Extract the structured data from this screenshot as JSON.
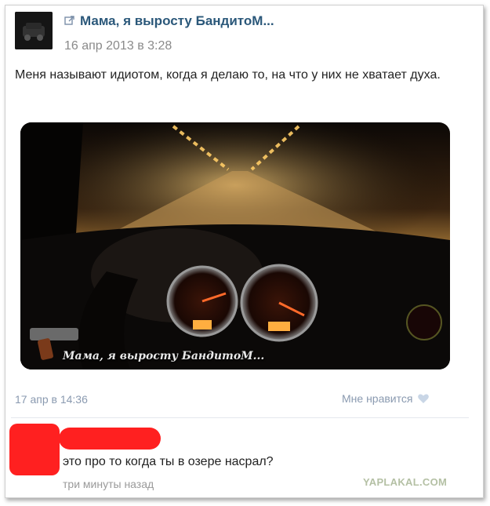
{
  "post": {
    "title": "Мама, я выросту БандитоМ...",
    "date": "16 апр 2013 в 3:28",
    "text": "Меня называют идиотом, когда я делаю то, на что у них не хватает духа.",
    "image_caption": "Мама, я выросту БандитоМ...",
    "repost_icon": "repost-arrow-icon"
  },
  "footer": {
    "date": "17 апр в 14:36",
    "like_label": "Мне нравится",
    "like_icon": "heart-icon"
  },
  "comment": {
    "text": "это про то когда ты в озере насрал?",
    "time": "три минуты назад"
  },
  "watermark": "YAPLAKAL.COM",
  "colors": {
    "title": "#2b587a",
    "meta": "#8a9ab0",
    "redaction": "#ff2020"
  }
}
